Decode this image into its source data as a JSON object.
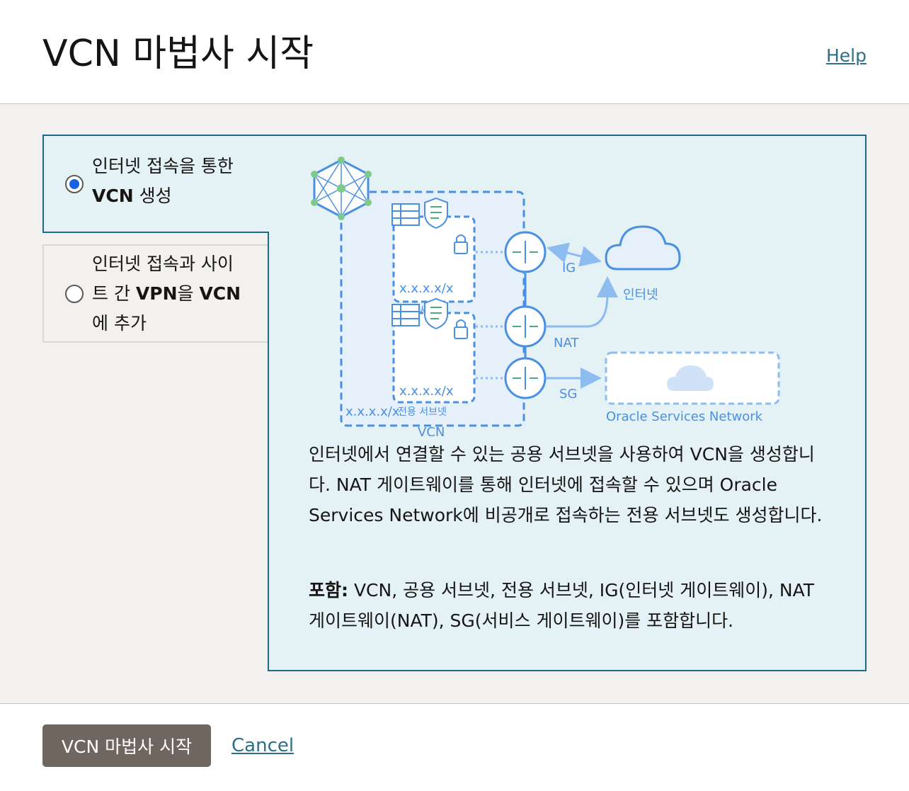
{
  "dialog": {
    "title": "VCN 마법사 시작",
    "help_link": "Help"
  },
  "options": [
    {
      "line1": "인터넷 접속을 통한",
      "line2_bold": "VCN",
      "line2_rest": " 생성",
      "selected": true
    },
    {
      "line1": "인터넷 접속과 사이",
      "line2_pre": "트 간 ",
      "line2_bold_a": "VPN",
      "line2_mid": "을 ",
      "line2_bold_b": "VCN",
      "line3": "에 추가",
      "selected": false
    }
  ],
  "diagram": {
    "public_subnet_cidr": "x.x.x.x/x",
    "public_subnet_label": "공용 서브넷",
    "private_subnet_cidr": "x.x.x.x/x",
    "private_subnet_label": "전용 서브넷",
    "vcn_cidr": "x.x.x.x/x",
    "vcn_label": "VCN",
    "ig_label": "IG",
    "nat_label": "NAT",
    "sg_label": "SG",
    "internet_label": "인터넷",
    "osn_label": "Oracle Services Network",
    "colors": {
      "line": "#4a90e2",
      "light_line": "#8dbcf0",
      "fill": "#e6f0fb",
      "arrow": "#4aae7a"
    }
  },
  "description": "인터넷에서 연결할 수 있는 공용 서브넷을 사용하여 VCN을 생성합니다. NAT 게이트웨이를 통해 인터넷에 접속할 수 있으며 Oracle Services Network에 비공개로 접속하는 전용 서브넷도 생성합니다.",
  "includes": {
    "label": "포함:",
    "text": " VCN, 공용 서브넷, 전용 서브넷, IG(인터넷 게이트웨이), NAT 게이트웨이(NAT), SG(서비스 게이트웨이)를 포함합니다."
  },
  "footer": {
    "start_button": "VCN 마법사 시작",
    "cancel_link": "Cancel"
  }
}
